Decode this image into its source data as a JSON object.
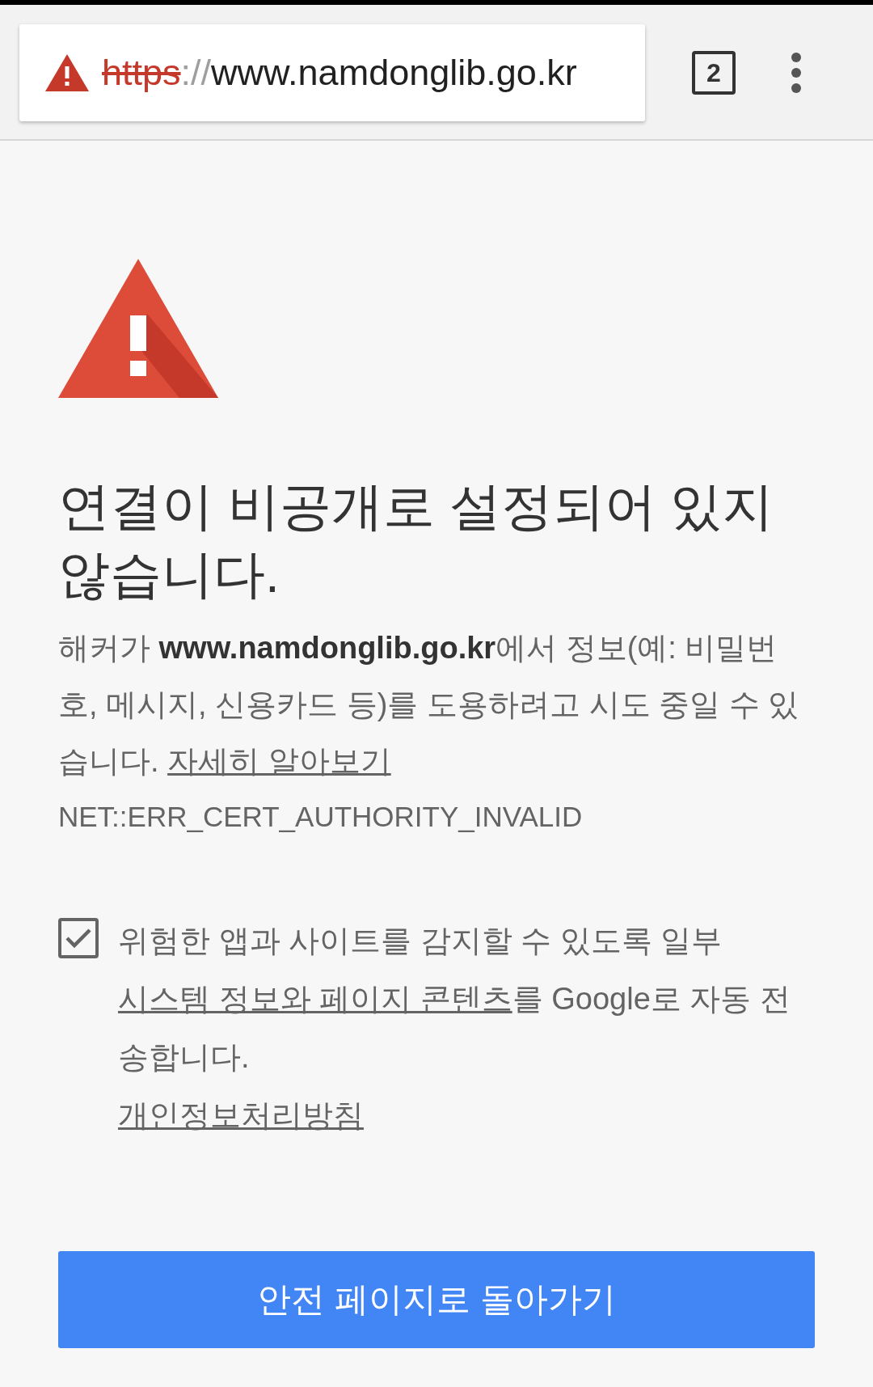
{
  "address_bar": {
    "insecure": true,
    "scheme": "https",
    "separator": "://",
    "host": "www.namdonglib.go.kr"
  },
  "tab_count": "2",
  "title": "연결이 비공개로 설정되어 있지 않습니다.",
  "description": "해커가 **www.namdonglib.go.kr**에서 정보(예: 비밀번호, 메시지, 신용카드 등)를 도용하려고 시도 중일 수 있습니다.",
  "learn_more_link": "자세히 알아보기",
  "error_code": "NET::ERR_CERT_AUTHORITY_INVALID",
  "report": {
    "checked": true,
    "text_before": "위험한 앱과 사이트를 감지할 수 있도록 일부",
    "link": "시스템 정보와 페이지 콘텐츠",
    "text_after": "를 Google로 자동 전송합니다.",
    "privacy_link": "개인정보처리방침"
  },
  "back_button": "안전 페이지로 돌아가기"
}
